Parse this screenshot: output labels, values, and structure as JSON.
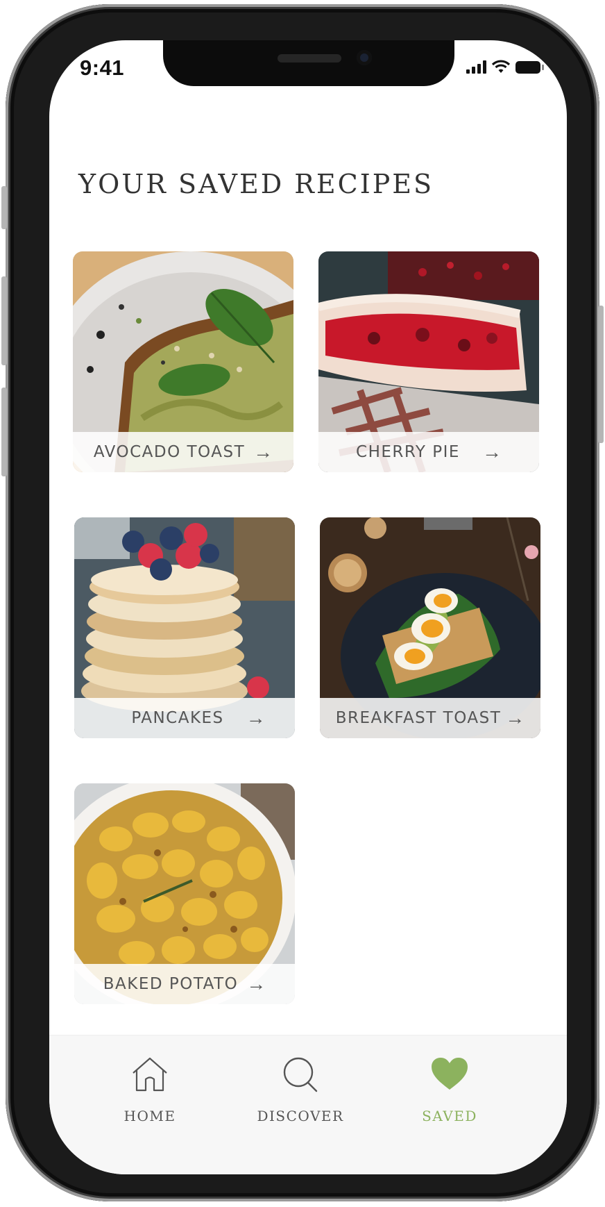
{
  "status_bar": {
    "time": "9:41"
  },
  "page": {
    "title": "YOUR SAVED RECIPES"
  },
  "recipes": [
    {
      "name": "AVOCADO TOAST",
      "image": "avocado-toast-photo"
    },
    {
      "name": "CHERRY PIE",
      "image": "cherry-pie-photo"
    },
    {
      "name": "PANCAKES",
      "image": "pancakes-photo"
    },
    {
      "name": "BREAKFAST TOAST",
      "image": "breakfast-toast-photo"
    },
    {
      "name": "BAKED POTATO",
      "image": "baked-potato-photo"
    }
  ],
  "nav": {
    "items": [
      {
        "label": "HOME",
        "icon": "home-icon"
      },
      {
        "label": "DISCOVER",
        "icon": "search-icon"
      },
      {
        "label": "SAVED",
        "icon": "heart-icon",
        "active": true
      }
    ]
  },
  "colors": {
    "accent": "#8cb25e",
    "text": "#555555"
  }
}
